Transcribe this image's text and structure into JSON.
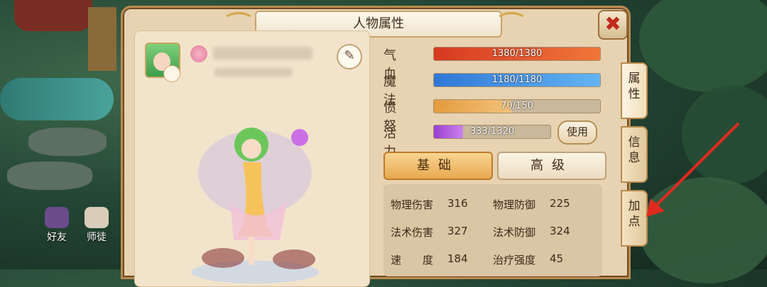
{
  "window": {
    "title": "人物属性",
    "close_symbol": "✖"
  },
  "character": {
    "edit_icon": "edit-icon"
  },
  "stats": [
    {
      "label": "气血",
      "current": 1380,
      "max": 1380,
      "text": "1380/1380",
      "color": "#e04c2b"
    },
    {
      "label": "魔法",
      "current": 1180,
      "max": 1180,
      "text": "1180/1180",
      "color": "#3c8fe0"
    },
    {
      "label": "愤怒",
      "current": 70,
      "max": 150,
      "text": "70/150",
      "color": "#e8a04a"
    },
    {
      "label": "活力",
      "current": 333,
      "max": 1320,
      "text": "333/1320",
      "color": "#a84fd8"
    }
  ],
  "use_button": "使用",
  "tabs": {
    "basic": "基础",
    "advanced": "高级"
  },
  "attributes": [
    {
      "label": "物理伤害",
      "value": "316"
    },
    {
      "label": "物理防御",
      "value": "225"
    },
    {
      "label": "法术伤害",
      "value": "327"
    },
    {
      "label": "法术防御",
      "value": "324"
    },
    {
      "label": "速　　度",
      "value": "184"
    },
    {
      "label": "治疗强度",
      "value": "45"
    }
  ],
  "side_tabs": [
    "属性",
    "信息",
    "加点"
  ],
  "left_buttons": [
    "好友",
    "师徒"
  ]
}
